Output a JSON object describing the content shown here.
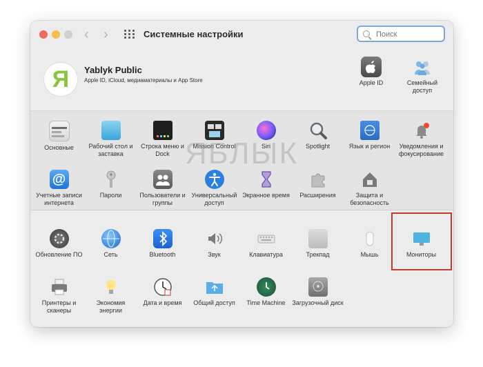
{
  "window": {
    "title": "Системные настройки"
  },
  "search": {
    "placeholder": "Поиск"
  },
  "account": {
    "avatar_letter": "Я",
    "name": "Yablyk Public",
    "subtitle": "Apple ID, iCloud, медиаматериалы и App Store",
    "items": [
      {
        "label": "Apple ID",
        "icon": "apple-icon"
      },
      {
        "label": "Семейный доступ",
        "icon": "family-icon"
      }
    ]
  },
  "section1": [
    {
      "label": "Основные",
      "icon": "general-icon"
    },
    {
      "label": "Рабочий стол и заставка",
      "icon": "desktop-icon"
    },
    {
      "label": "Строка меню и Dock",
      "icon": "dock-icon"
    },
    {
      "label": "Mission Control",
      "icon": "mission-control-icon"
    },
    {
      "label": "Siri",
      "icon": "siri-icon"
    },
    {
      "label": "Spotlight",
      "icon": "spotlight-icon"
    },
    {
      "label": "Язык и регион",
      "icon": "flag-icon"
    },
    {
      "label": "Уведомления и фокусирование",
      "icon": "bell-icon"
    },
    {
      "label": "Учетные записи интернета",
      "icon": "at-icon"
    },
    {
      "label": "Пароли",
      "icon": "key-icon"
    },
    {
      "label": "Пользователи и группы",
      "icon": "users-icon"
    },
    {
      "label": "Универсальный доступ",
      "icon": "accessibility-icon"
    },
    {
      "label": "Экранное время",
      "icon": "hourglass-icon"
    },
    {
      "label": "Расширения",
      "icon": "puzzle-icon"
    },
    {
      "label": "Защита и безопасность",
      "icon": "house-lock-icon"
    }
  ],
  "section2": [
    {
      "label": "Обновление ПО",
      "icon": "gear-icon"
    },
    {
      "label": "Сеть",
      "icon": "globe-icon"
    },
    {
      "label": "Bluetooth",
      "icon": "bluetooth-icon"
    },
    {
      "label": "Звук",
      "icon": "speaker-icon"
    },
    {
      "label": "Клавиатура",
      "icon": "keyboard-icon"
    },
    {
      "label": "Трекпад",
      "icon": "trackpad-icon"
    },
    {
      "label": "Мышь",
      "icon": "mouse-icon"
    },
    {
      "label": "Мониторы",
      "icon": "display-icon"
    },
    {
      "label": "Принтеры и сканеры",
      "icon": "printer-icon"
    },
    {
      "label": "Экономия энергии",
      "icon": "bulb-icon"
    },
    {
      "label": "Дата и время",
      "icon": "clock-icon"
    },
    {
      "label": "Общий доступ",
      "icon": "shared-folder-icon"
    },
    {
      "label": "Time Machine",
      "icon": "time-machine-icon"
    },
    {
      "label": "Загрузочный диск",
      "icon": "disk-icon"
    }
  ],
  "watermark": "ЯБЛЫК"
}
